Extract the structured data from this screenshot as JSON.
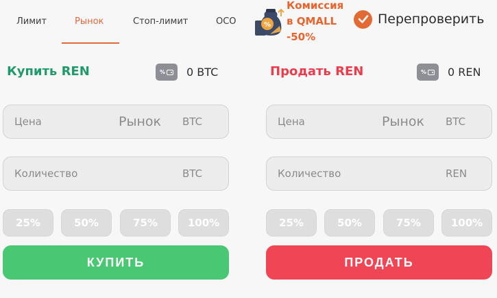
{
  "tabs": [
    {
      "label": "Лимит"
    },
    {
      "label": "Рынок"
    },
    {
      "label": "Стоп-лимит"
    },
    {
      "label": "OCO"
    }
  ],
  "active_tab": "Рынок",
  "promo": {
    "line1": "Комиссия",
    "line2": "в QMALL",
    "line3": "-50%"
  },
  "recheck": {
    "label": "Перепроверить"
  },
  "buy": {
    "title": "Купить REN",
    "wallet_icon_text": "%",
    "balance": "0 BTC",
    "price_placeholder": "Цена",
    "price_market": "Рынок",
    "price_unit": "BTC",
    "qty_placeholder": "Количество",
    "qty_unit": "BTC",
    "percents": [
      "25%",
      "50%",
      "75%",
      "100%"
    ],
    "action_label": "КУПИТЬ"
  },
  "sell": {
    "title": "Продать REN",
    "wallet_icon_text": "%",
    "balance": "0 REN",
    "price_placeholder": "Цена",
    "price_market": "Рынок",
    "price_unit": "BTC",
    "qty_placeholder": "Количество",
    "qty_unit": "REN",
    "percents": [
      "25%",
      "50%",
      "75%",
      "100%"
    ],
    "action_label": "ПРОДАТЬ"
  },
  "colors": {
    "accent": "#e0683a",
    "buy": "#49c772",
    "buy_title": "#1f9a6b",
    "sell": "#f04555"
  }
}
